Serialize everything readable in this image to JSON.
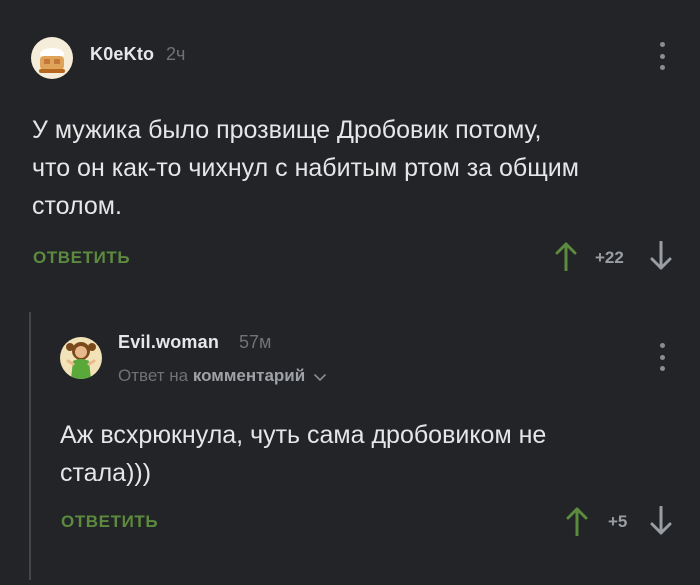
{
  "comment1": {
    "author": "K0eKto",
    "time": "2ч",
    "text_line1": "У мужика было прозвище Дробовик потому,",
    "text_line2": "что он как-то чихнул с набитым ртом за общим",
    "text_line3": "столом.",
    "reply_label": "ОТВЕТИТЬ",
    "rating": "+22"
  },
  "comment2": {
    "author": "Evil.woman",
    "time": "57м",
    "reply_to_prefix": "Ответ на",
    "reply_to_target": "комментарий",
    "text_line1": "Аж всхрюкнула, чуть сама дробовиком не",
    "text_line2": "стала)))",
    "reply_label": "ОТВЕТИТЬ",
    "rating": "+5"
  },
  "colors": {
    "background": "#232427",
    "reply_green": "#5c8a3f",
    "upvote_green": "#5c8a3f",
    "muted": "#6f7276"
  },
  "icons": [
    "more-vertical-icon",
    "upvote-arrow-icon",
    "downvote-arrow-icon",
    "chevron-down-icon"
  ]
}
